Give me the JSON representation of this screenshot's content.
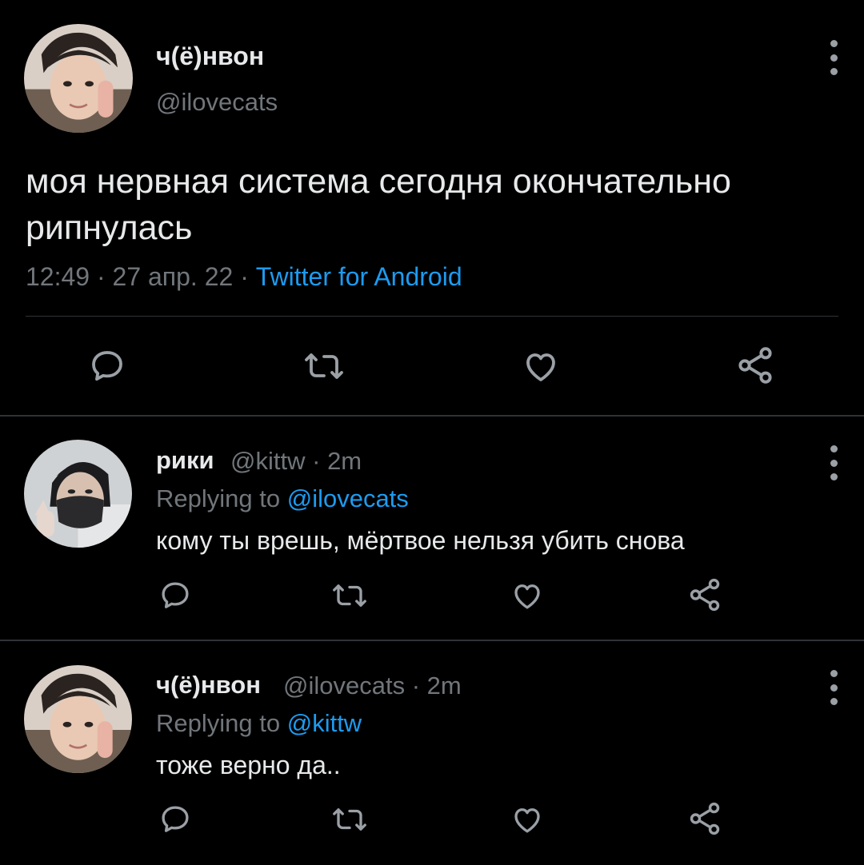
{
  "main_tweet": {
    "display_name": "ч(ё)нвон",
    "handle": "@ilovecats",
    "text": "моя нервная система сегодня окончательно рипнулась",
    "time": "12:49",
    "date": "27 апр. 22",
    "separator": "·",
    "source": "Twitter for Android",
    "avatar_icon": "avatar-photo"
  },
  "replies": [
    {
      "display_name": "рики",
      "handle": "@kittw",
      "separator": "·",
      "age": "2m",
      "replying_label": "Replying to",
      "replying_to": "@ilovecats",
      "text": "кому ты врешь, мёртвое нельзя убить снова"
    },
    {
      "display_name": "ч(ё)нвон",
      "handle": "@ilovecats",
      "separator": "·",
      "age": "2m",
      "replying_label": "Replying to",
      "replying_to": "@kittw",
      "text": "тоже верно да.."
    }
  ],
  "icons": [
    "more-icon",
    "reply-icon",
    "retweet-icon",
    "like-icon",
    "share-icon"
  ],
  "colors": {
    "background": "#000000",
    "text": "#e7e9ea",
    "secondary": "#71767b",
    "link": "#1d9bf0",
    "divider": "#2f3336"
  }
}
